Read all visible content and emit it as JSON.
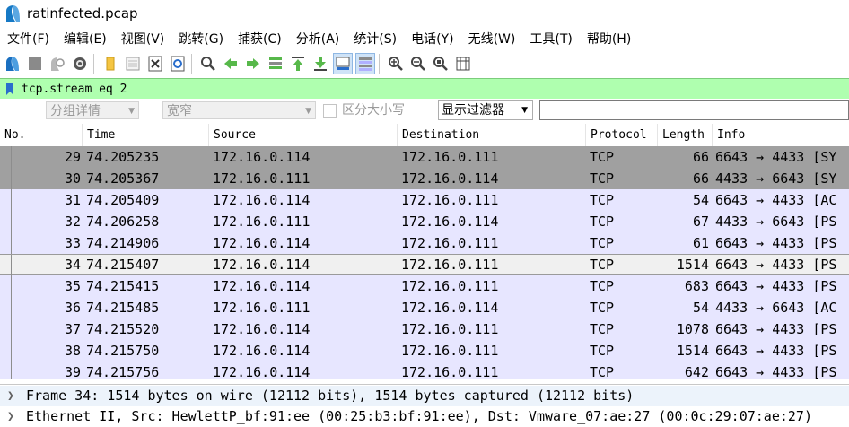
{
  "window": {
    "title": "ratinfected.pcap"
  },
  "menu": [
    "文件(F)",
    "编辑(E)",
    "视图(V)",
    "跳转(G)",
    "捕获(C)",
    "分析(A)",
    "统计(S)",
    "电话(Y)",
    "无线(W)",
    "工具(T)",
    "帮助(H)"
  ],
  "toolbar": {
    "buttons": [
      "start-capture",
      "stop-capture",
      "restart-capture",
      "capture-options",
      "open-file",
      "save-file",
      "close-file",
      "reload-file",
      "find-packet",
      "go-back",
      "go-forward",
      "go-to-packet",
      "go-first",
      "go-last",
      "auto-scroll",
      "colorize",
      "zoom-in",
      "zoom-out",
      "zoom-normal",
      "resize-columns"
    ]
  },
  "filter": {
    "value": "tcp.stream eq 2"
  },
  "find": {
    "scope": "分组详情",
    "charset": "宽窄",
    "case_label": "区分大小写",
    "type": "显示过滤器",
    "value": ""
  },
  "columns": [
    "No.",
    "Time",
    "Source",
    "Destination",
    "Protocol",
    "Length",
    "Info"
  ],
  "packets": [
    {
      "no": "29",
      "time": "74.205235",
      "src": "172.16.0.114",
      "dst": "172.16.0.111",
      "proto": "TCP",
      "len": "66",
      "info": "6643 → 4433 [SY",
      "style": "marked"
    },
    {
      "no": "30",
      "time": "74.205367",
      "src": "172.16.0.111",
      "dst": "172.16.0.114",
      "proto": "TCP",
      "len": "66",
      "info": "4433 → 6643 [SY",
      "style": "marked"
    },
    {
      "no": "31",
      "time": "74.205409",
      "src": "172.16.0.114",
      "dst": "172.16.0.111",
      "proto": "TCP",
      "len": "54",
      "info": "6643 → 4433 [AC",
      "style": "normal"
    },
    {
      "no": "32",
      "time": "74.206258",
      "src": "172.16.0.111",
      "dst": "172.16.0.114",
      "proto": "TCP",
      "len": "67",
      "info": "4433 → 6643 [PS",
      "style": "normal"
    },
    {
      "no": "33",
      "time": "74.214906",
      "src": "172.16.0.114",
      "dst": "172.16.0.111",
      "proto": "TCP",
      "len": "61",
      "info": "6643 → 4433 [PS",
      "style": "normal"
    },
    {
      "no": "34",
      "time": "74.215407",
      "src": "172.16.0.114",
      "dst": "172.16.0.111",
      "proto": "TCP",
      "len": "1514",
      "info": "6643 → 4433 [PS",
      "style": "selected"
    },
    {
      "no": "35",
      "time": "74.215415",
      "src": "172.16.0.114",
      "dst": "172.16.0.111",
      "proto": "TCP",
      "len": "683",
      "info": "6643 → 4433 [PS",
      "style": "normal"
    },
    {
      "no": "36",
      "time": "74.215485",
      "src": "172.16.0.111",
      "dst": "172.16.0.114",
      "proto": "TCP",
      "len": "54",
      "info": "4433 → 6643 [AC",
      "style": "normal"
    },
    {
      "no": "37",
      "time": "74.215520",
      "src": "172.16.0.114",
      "dst": "172.16.0.111",
      "proto": "TCP",
      "len": "1078",
      "info": "6643 → 4433 [PS",
      "style": "normal"
    },
    {
      "no": "38",
      "time": "74.215750",
      "src": "172.16.0.114",
      "dst": "172.16.0.111",
      "proto": "TCP",
      "len": "1514",
      "info": "6643 → 4433 [PS",
      "style": "normal"
    },
    {
      "no": "39",
      "time": "74.215756",
      "src": "172.16.0.114",
      "dst": "172.16.0.111",
      "proto": "TCP",
      "len": "642",
      "info": "6643 → 4433 [PS",
      "style": "normal"
    }
  ],
  "details": [
    "Frame 34: 1514 bytes on wire (12112 bits), 1514 bytes captured (12112 bits)",
    "Ethernet II, Src: HewlettP_bf:91:ee (00:25:b3:bf:91:ee), Dst: Vmware_07:ae:27 (00:0c:29:07:ae:27)"
  ],
  "colors": {
    "filter_bg": "#afffaf",
    "row_normal": "#e7e6ff",
    "row_marked": "#a0a0a0",
    "row_selected": "#f0f0f0",
    "details_highlight": "#ecf3fb"
  }
}
